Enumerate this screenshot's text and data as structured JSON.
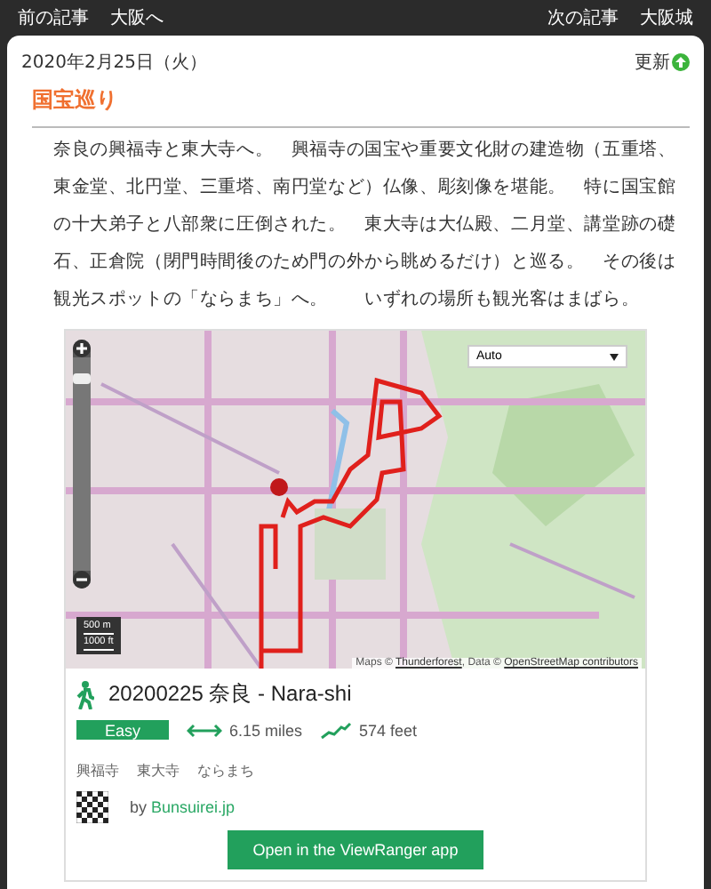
{
  "top_nav": {
    "left": [
      {
        "label": "前の記事"
      },
      {
        "label": "大阪へ"
      }
    ],
    "right": [
      {
        "label": "次の記事"
      },
      {
        "label": "大阪城"
      }
    ]
  },
  "post": {
    "date": "2020年2月25日（火）",
    "update": "更新",
    "title": "国宝巡り",
    "body": "奈良の興福寺と東大寺へ。　興福寺の国宝や重要文化財の建造物（五重塔、東金堂、北円堂、三重塔、南円堂など）仏像、彫刻像を堪能。　特に国宝館の十大弟子と八部衆に圧倒された。　東大寺は大仏殿、二月堂、講堂跡の礎石、正倉院（閉門時間後のため門の外から眺めるだけ）と巡る。　その後は観光スポットの「ならまち」へ。　　いずれの場所も観光客はまばら。"
  },
  "map": {
    "kind": "picture",
    "layer_select": "Auto",
    "zoom": {
      "level": 0.92
    },
    "scale": [
      "500 m",
      "1000 ft"
    ],
    "attribution": [
      {
        "text": "Maps © ",
        "link": false
      },
      {
        "text": "Thunderforest",
        "link": true
      },
      {
        "text": ", Data © ",
        "link": false
      },
      {
        "text": "OpenStreetMap contributors",
        "link": true
      }
    ]
  },
  "route": {
    "title": "20200225 奈良 - Nara-shi",
    "difficulty": "Easy",
    "distance": "6.15 miles",
    "ascent": "574 feet",
    "tags": [
      "興福寺",
      "東大寺",
      "ならまち"
    ],
    "by": "by",
    "author": "Bunsuirei.jp",
    "button": "Open in the ViewRanger app"
  }
}
